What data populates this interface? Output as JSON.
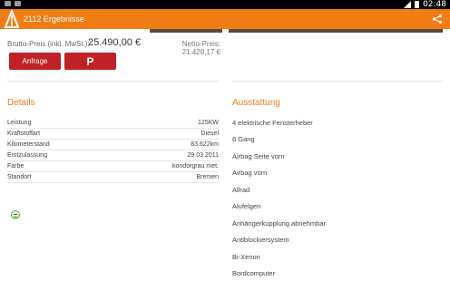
{
  "status_bar": {
    "time": "02:48"
  },
  "app_bar": {
    "title": "2112 Ergebnisse"
  },
  "price": {
    "brutto_label": "Brutto-Preis (inkl. MwSt.):",
    "brutto_value": "25.490,00 €",
    "netto": "Netto-Preis: 21.420,17 €"
  },
  "buttons": {
    "anfrage": "Anfrage",
    "park": "P"
  },
  "details": {
    "title": "Details",
    "rows": [
      {
        "label": "Leistung",
        "value": "125KW"
      },
      {
        "label": "Kraftstoffart",
        "value": "Diesel"
      },
      {
        "label": "Kilometerstand",
        "value": "83.622km"
      },
      {
        "label": "Erstzulassung",
        "value": "29.03.2011"
      },
      {
        "label": "Farbe",
        "value": "kondorgrau met."
      },
      {
        "label": "Standort",
        "value": "Bremen"
      }
    ]
  },
  "equipment": {
    "title": "Ausstattung",
    "items": [
      "4 elektrische Fensterheber",
      "6 Gang",
      "Airbag Seite vorn",
      "Airbag vorn",
      "Allrad",
      "Alufelgen",
      "Anhängerkupplung abnehmbar",
      "Antiblockiersystem",
      "Bi-Xenon",
      "Bordcomputer"
    ]
  },
  "colors": {
    "accent": "#f07d14",
    "button": "#c02126"
  }
}
